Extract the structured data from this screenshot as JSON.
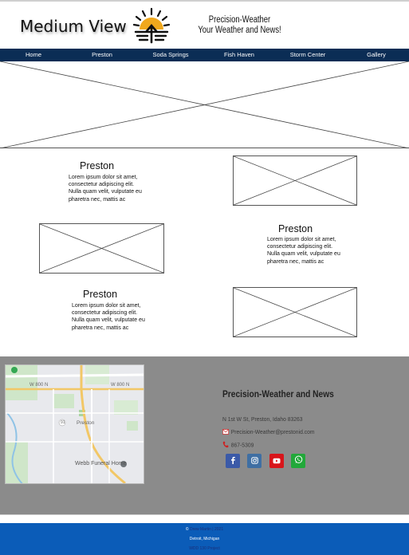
{
  "header": {
    "view_title": "Medium View",
    "brand_name": "Precision-Weather",
    "brand_tagline": "Your Weather and News!"
  },
  "nav": {
    "items": [
      {
        "label": "Home"
      },
      {
        "label": "Preston"
      },
      {
        "label": "Soda Springs"
      },
      {
        "label": "Fish Haven"
      },
      {
        "label": "Storm Center"
      },
      {
        "label": "Gallery"
      }
    ]
  },
  "cards": [
    {
      "title": "Preston",
      "text": "Lorem ipsum dolor sit amet, consectetur adipiscing elit. Nulla quam velit, vulputate eu pharetra nec, mattis ac"
    },
    {
      "title": "Preston",
      "text": "Lorem ipsum dolor sit amet, consectetur adipiscing elit. Nulla quam velit, vulputate eu pharetra nec, mattis ac"
    },
    {
      "title": "Preston",
      "text": "Lorem ipsum dolor sit amet, consectetur adipiscing elit. Nulla quam velit, vulputate eu pharetra nec, mattis ac"
    }
  ],
  "map": {
    "labels": {
      "road_w_800": "W 800 N",
      "road_w_800_2": "W 800 N",
      "route": "91",
      "town": "Preston",
      "poi": "Webb Funeral Home"
    }
  },
  "footer": {
    "title": "Precision-Weather and News",
    "address": "N 1st W St, Preston, Idaho 83263",
    "email": "Precision-Weather@prestonid.com",
    "phone": "867-5309",
    "social": [
      "facebook",
      "instagram",
      "youtube",
      "whatsapp"
    ]
  },
  "copyright": {
    "prefix": "© ",
    "name_link": "Drew Martin | 2021",
    "location": "Detroit, Michigan",
    "extra_link": "WDD 130 Project"
  },
  "colors": {
    "nav": "#0b2d55",
    "footer_band": "#8b8b8b",
    "bottom_bar": "#0b5cb8",
    "logo_sun": "#f0a81c",
    "facebook": "#3b5aa8",
    "instagram": "#3f6fa3",
    "youtube": "#d8151b",
    "whatsapp": "#22a83a"
  }
}
